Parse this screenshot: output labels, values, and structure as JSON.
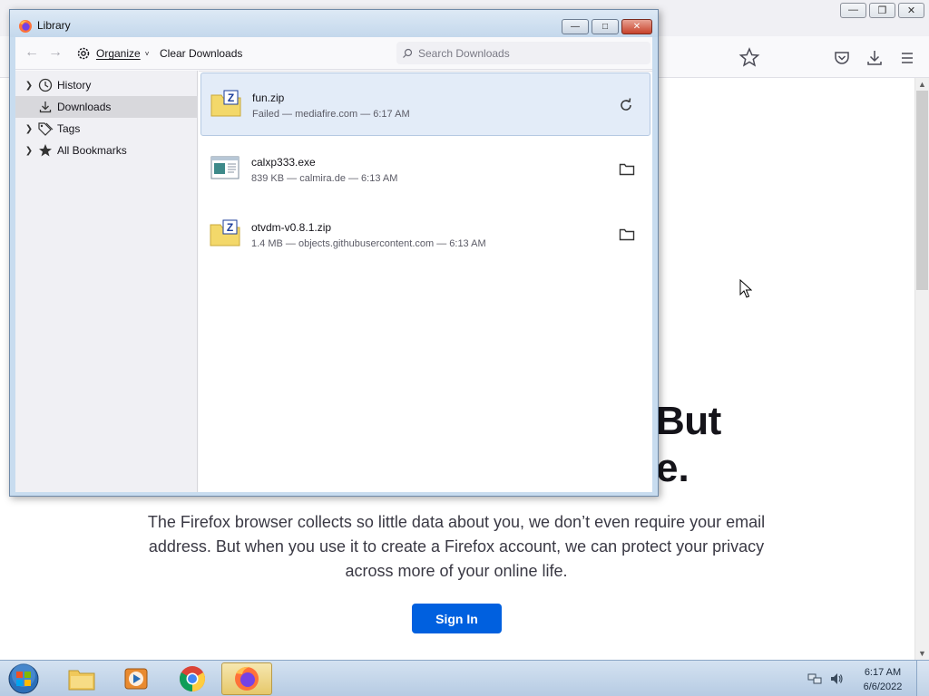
{
  "browser": {
    "hero_line1": "But",
    "hero_line2": "e.",
    "body_text": "The Firefox browser collects so little data about you, we don’t even require your email address. But when you use it to create a Firefox account, we can protect your privacy across more of your online life.",
    "sign_in_label": "Sign In",
    "window_controls": [
      "minimize",
      "restore",
      "close"
    ],
    "toolbar_icons": [
      "bookmark-star-icon",
      "pocket-icon",
      "downloads-icon",
      "menu-icon"
    ]
  },
  "library": {
    "title": "Library",
    "toolbar": {
      "organize_label": "Organize",
      "clear_downloads_label": "Clear Downloads",
      "search_placeholder": "Search Downloads"
    },
    "sidebar": {
      "items": [
        {
          "label": "History",
          "icon": "clock-icon",
          "expandable": true,
          "selected": false
        },
        {
          "label": "Downloads",
          "icon": "download-icon",
          "expandable": false,
          "selected": true
        },
        {
          "label": "Tags",
          "icon": "tags-icon",
          "expandable": true,
          "selected": false
        },
        {
          "label": "All Bookmarks",
          "icon": "star-icon",
          "expandable": true,
          "selected": false
        }
      ]
    },
    "downloads": [
      {
        "name": "fun.zip",
        "meta": "Failed — mediafire.com — 6:17 AM",
        "icon": "zip-archive-icon",
        "action": "retry-icon",
        "selected": true
      },
      {
        "name": "calxp333.exe",
        "meta": "839 KB — calmira.de — 6:13 AM",
        "icon": "executable-icon",
        "action": "folder-icon",
        "selected": false
      },
      {
        "name": "otvdm-v0.8.1.zip",
        "meta": "1.4 MB — objects.githubusercontent.com — 6:13 AM",
        "icon": "zip-archive-icon",
        "action": "folder-icon",
        "selected": false
      }
    ]
  },
  "taskbar": {
    "items": [
      "start-orb",
      "windows-explorer",
      "media-player",
      "google-chrome",
      "firefox"
    ],
    "active_item": "firefox",
    "clock_time": "6:17 AM",
    "clock_date": "6/6/2022"
  },
  "colors": {
    "accent_blue": "#0060df",
    "selected_row": "#e3ecf8",
    "sidebar_bg": "#f0f0f4"
  }
}
